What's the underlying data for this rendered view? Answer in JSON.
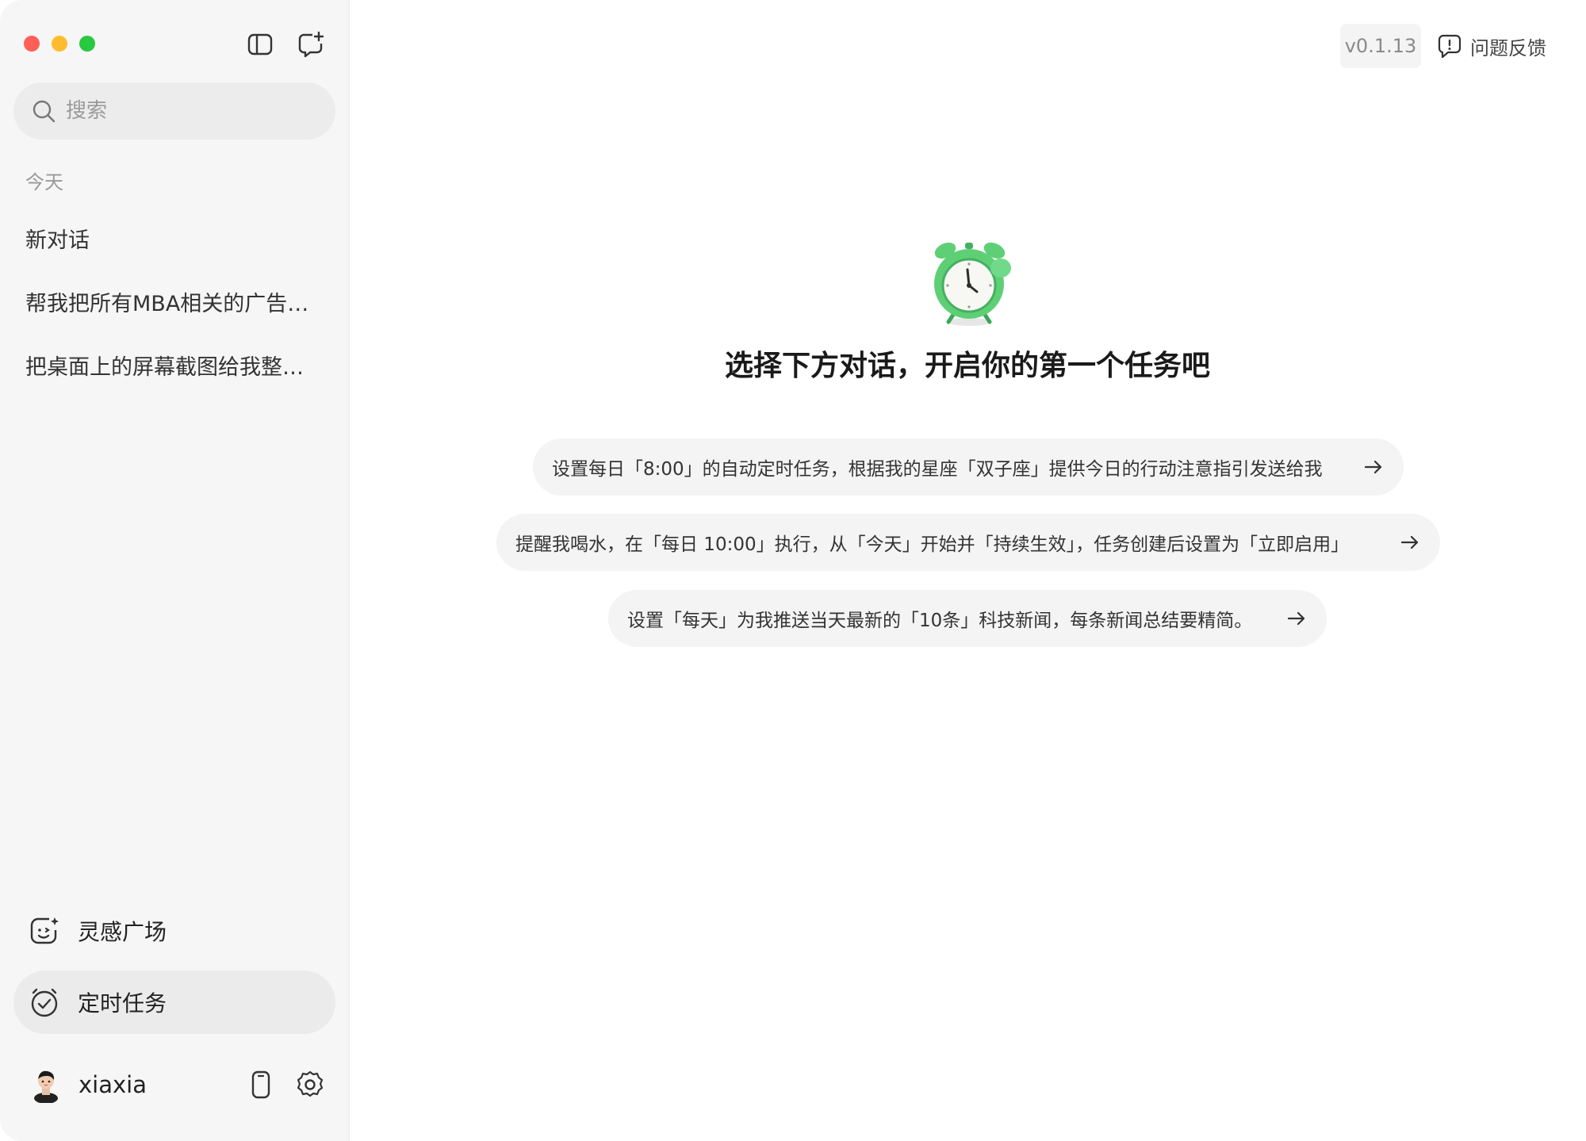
{
  "sidebar": {
    "search_placeholder": "搜索",
    "section_today": "今天",
    "history": [
      "新对话",
      "帮我把所有MBA相关的广告…",
      "把桌面上的屏幕截图给我整…"
    ],
    "nav": {
      "inspiration": "灵感广场",
      "scheduled_tasks": "定时任务"
    },
    "user": {
      "name": "xiaxia"
    }
  },
  "header": {
    "version": "v0.1.13",
    "feedback": "问题反馈"
  },
  "main": {
    "title": "选择下方对话，开启你的第一个任务吧",
    "suggestions": [
      "设置每日「8:00」的自动定时任务，根据我的星座「双子座」提供今日的行动注意指引发送给我",
      "提醒我喝水，在「每日 10:00」执行，从「今天」开始并「持续生效」，任务创建后设置为「立即启用」",
      "设置「每天」为我推送当天最新的「10条」科技新闻，每条新闻总结要精简。"
    ]
  },
  "colors": {
    "sidebar_bg": "#f6f6f6",
    "accent_green": "#5fcf76",
    "suggestion_bg": "#f4f4f4"
  },
  "icons": {
    "sidebar_toggle": "sidebar-toggle-icon",
    "new_chat": "new-chat-icon",
    "search": "search-icon",
    "inspiration": "smile-sparkle-icon",
    "scheduled": "clock-check-icon",
    "phone": "phone-icon",
    "settings": "gear-icon",
    "feedback": "feedback-icon",
    "hero": "alarm-clock-icon",
    "arrow": "arrow-right-icon"
  }
}
